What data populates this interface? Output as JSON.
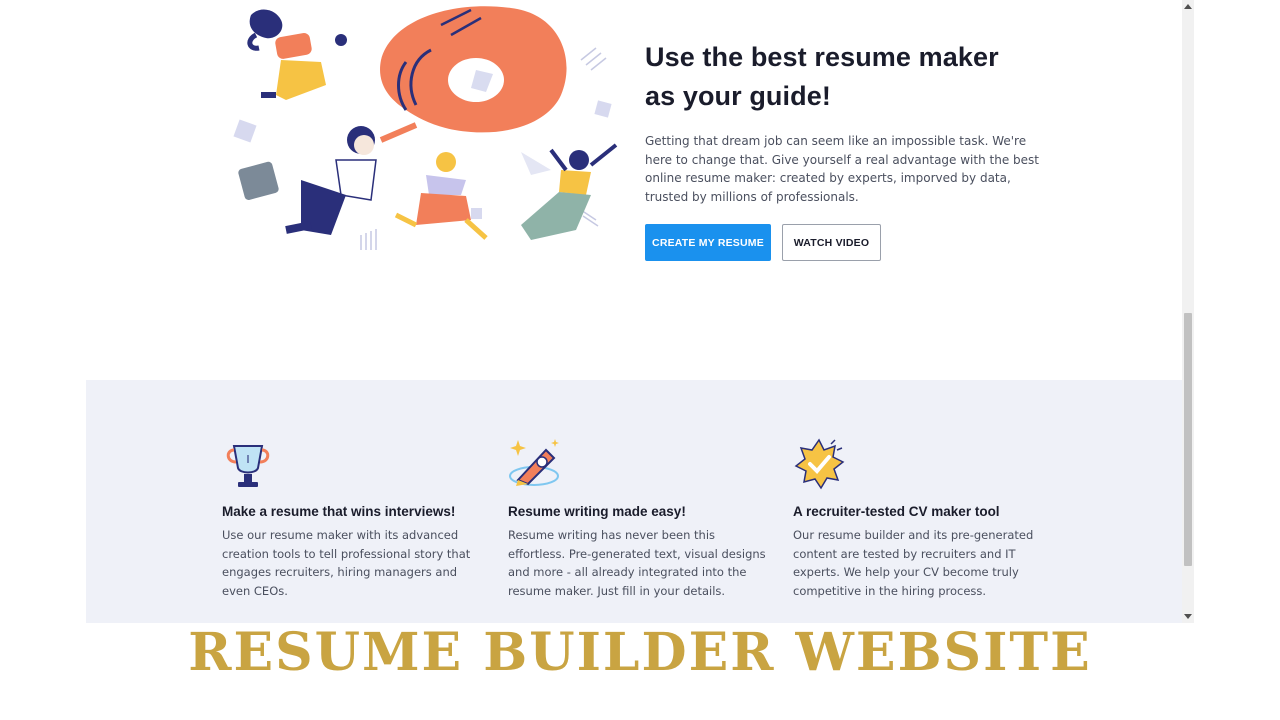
{
  "hero": {
    "title_line1": "Use the best resume maker",
    "title_line2": "as your guide!",
    "description": "Getting that dream job can seem like an impossible task. We're here to change that. Give yourself a real advantage with the best online resume maker: created by experts, imporved by data, trusted by millions of professionals.",
    "primary_button": "CREATE MY RESUME",
    "secondary_button": "WATCH VIDEO"
  },
  "features": [
    {
      "icon": "trophy-icon",
      "title": "Make a resume that wins interviews!",
      "description": "Use our resume maker with its advanced creation tools to tell professional story that engages recruiters, hiring managers and even CEOs."
    },
    {
      "icon": "pen-sparkle-icon",
      "title": "Resume writing made easy!",
      "description": "Resume writing has never been this effortless. Pre-generated text, visual designs and more - all already integrated into the resume maker. Just fill in your details."
    },
    {
      "icon": "checkmark-badge-icon",
      "title": "A recruiter-tested CV maker tool",
      "description": "Our resume builder and its pre-generated content are tested by recruiters and IT experts. We help your CV become truly competitive in the hiring process."
    }
  ],
  "banner": {
    "text": "RESUME BUILDER WEBSITE"
  },
  "colors": {
    "primary": "#1a91ee",
    "features_bg": "#eff1f8",
    "banner": "#c9a442",
    "illustration_orange": "#f27f5a"
  }
}
